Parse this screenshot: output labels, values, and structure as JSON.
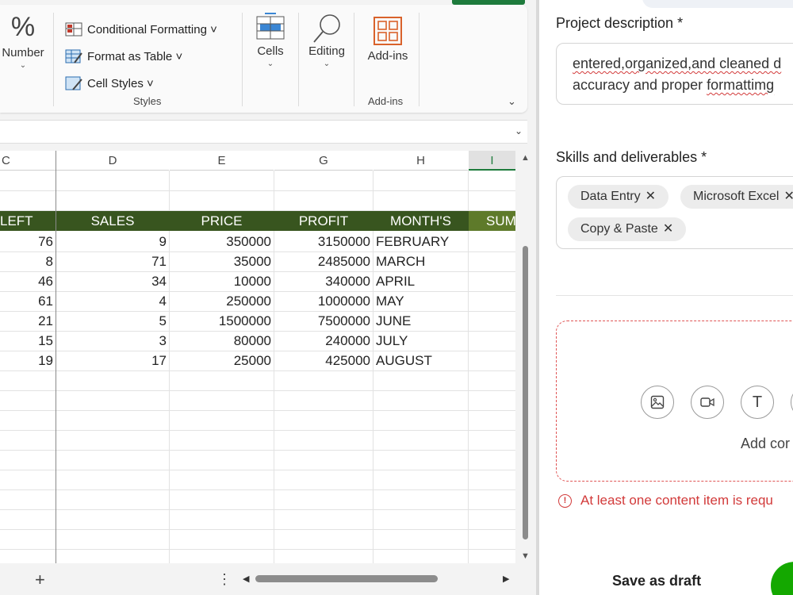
{
  "ribbon": {
    "number_label": "Number",
    "number_icon": "%",
    "styles": {
      "items": [
        {
          "label": "Conditional Formatting ˅"
        },
        {
          "label": "Format as Table ˅"
        },
        {
          "label": "Cell Styles ˅"
        }
      ],
      "group_label": "Styles"
    },
    "cells_label": "Cells",
    "editing_label": "Editing",
    "addins_label": "Add-ins",
    "addins_group_label": "Add-ins",
    "accent_color": "#1e7b3c"
  },
  "sheet": {
    "columns": [
      "C",
      "D",
      "E",
      "G",
      "H",
      "I"
    ],
    "selected_column": "I",
    "header_row": [
      "LEFT",
      "SALES",
      "PRICE",
      "PROFIT",
      "MONTH'S",
      "SUM"
    ],
    "header_fill": "#38551f",
    "rows": [
      [
        "76",
        "9",
        "350000",
        "3150000",
        "FEBRUARY"
      ],
      [
        "8",
        "71",
        "35000",
        "2485000",
        "MARCH"
      ],
      [
        "46",
        "34",
        "10000",
        "340000",
        "APRIL"
      ],
      [
        "61",
        "4",
        "250000",
        "1000000",
        "MAY"
      ],
      [
        "21",
        "5",
        "1500000",
        "7500000",
        "JUNE"
      ],
      [
        "15",
        "3",
        "80000",
        "240000",
        "JULY"
      ],
      [
        "19",
        "17",
        "25000",
        "425000",
        "AUGUST"
      ]
    ]
  },
  "statusbar": {
    "add_sheet": "+",
    "more": "⋮"
  },
  "form": {
    "description_label": "Project description *",
    "description_line1": "entered,organized,and cleaned d",
    "description_line2_a": "accuracy and proper ",
    "description_line2_b": "formattimg",
    "skills_label": "Skills and deliverables *",
    "chips": [
      "Data Entry",
      "Microsoft Excel",
      "Copy & Paste"
    ],
    "chip_remove": "✕",
    "add_content": "Add cor",
    "error_text": "At least one content item is requ",
    "save_draft": "Save as draft",
    "brand_color": "#14a800",
    "error_color": "#d23a3a"
  }
}
